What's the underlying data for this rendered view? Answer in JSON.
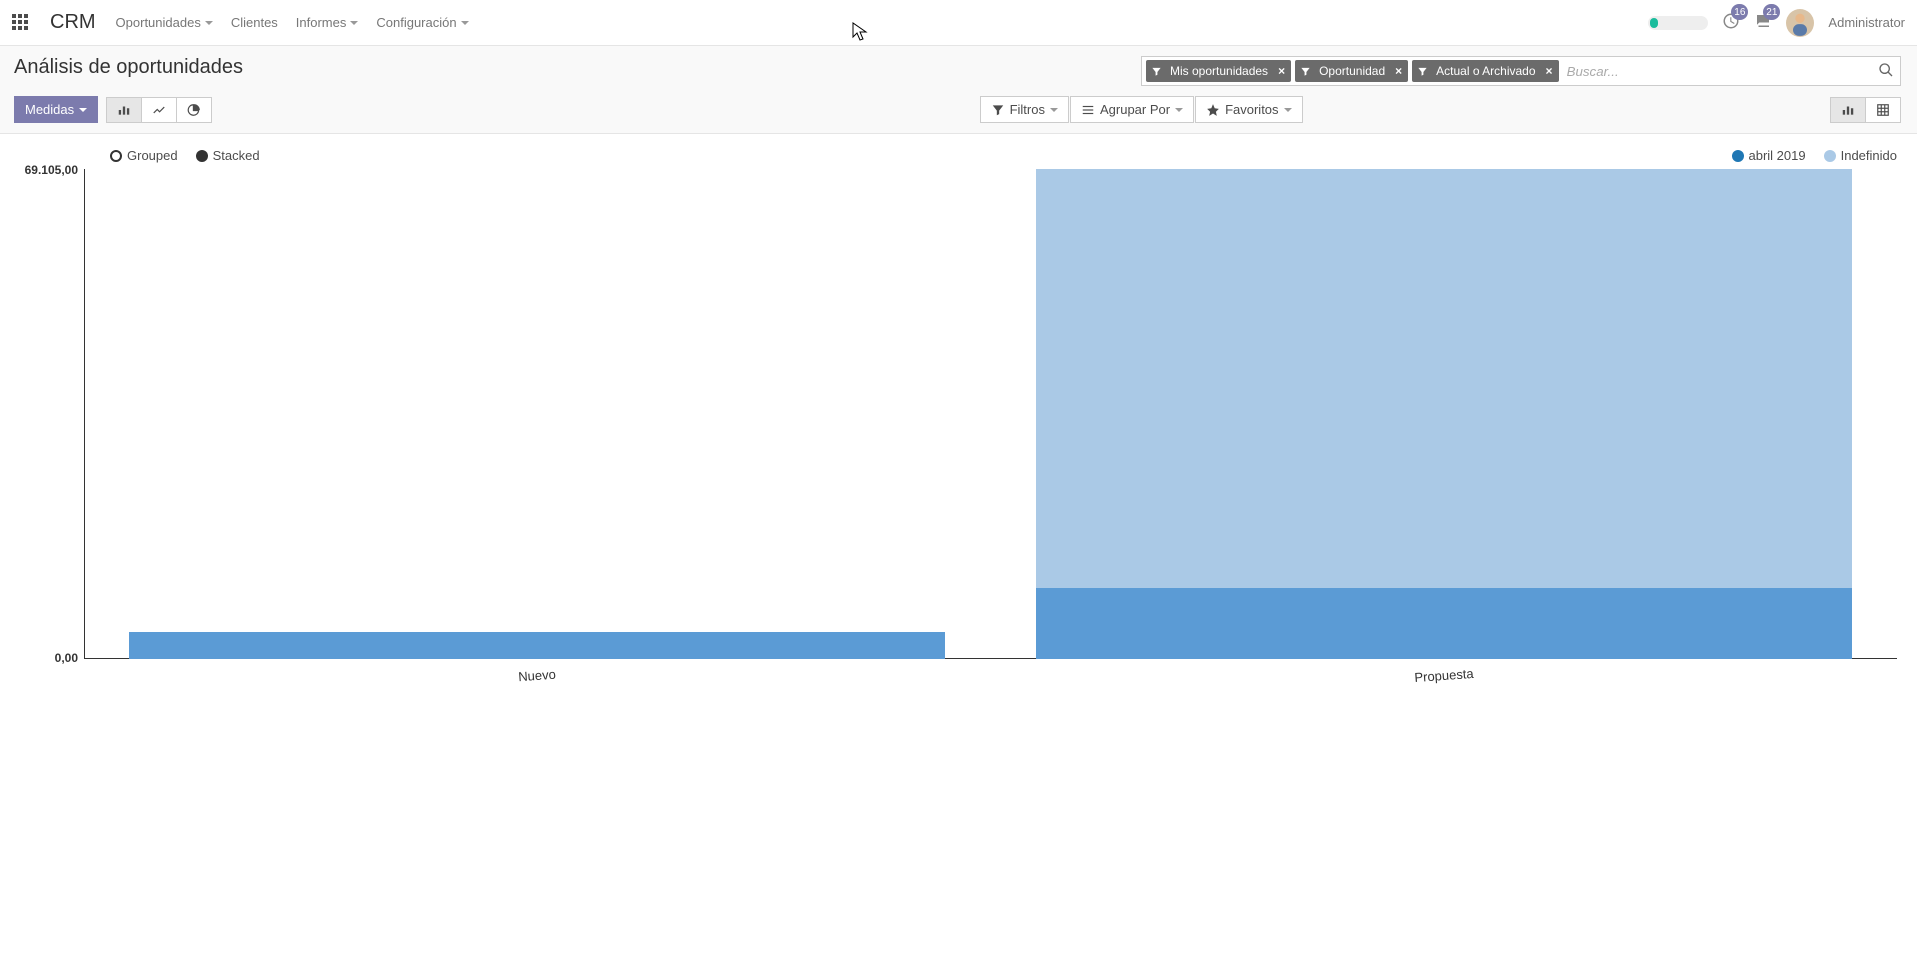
{
  "navbar": {
    "brand": "CRM",
    "menu": {
      "oportunidades": "Oportunidades",
      "clientes": "Clientes",
      "informes": "Informes",
      "configuracion": "Configuración"
    },
    "badges": {
      "activities": "16",
      "messages": "21"
    },
    "user": "Administrator"
  },
  "breadcrumb": "Análisis de oportunidades",
  "search": {
    "placeholder": "Buscar...",
    "facets": {
      "mis_oportunidades": "Mis oportunidades",
      "oportunidad": "Oportunidad",
      "actual_archivado": "Actual o Archivado"
    }
  },
  "toolbar": {
    "medidas": "Medidas",
    "filtros": "Filtros",
    "agrupar": "Agrupar Por",
    "favoritos": "Favoritos"
  },
  "chart": {
    "legend_mode": {
      "grouped": "Grouped",
      "stacked": "Stacked"
    },
    "legend_series": {
      "abril_2019": "abril 2019",
      "indefinido": "Indefinido"
    },
    "y_ticks": {
      "max": "69.105,00",
      "min": "0,00"
    },
    "categories": {
      "nuevo": "Nuevo",
      "propuesta": "Propuesta"
    }
  },
  "colors": {
    "abril_2019": "#5b9bd5",
    "indefinido": "#aac9e6",
    "stacked_dot": "#333",
    "grouped_dot_border": "#333"
  },
  "chart_data": {
    "type": "bar",
    "stacked": true,
    "xlabel": "",
    "ylabel": "",
    "ylim": [
      0,
      69105
    ],
    "y_ticks_shown": [
      0,
      69105
    ],
    "categories": [
      "Nuevo",
      "Propuesta"
    ],
    "series": [
      {
        "name": "abril 2019",
        "color": "#5b9bd5",
        "values": [
          3800,
          10000
        ]
      },
      {
        "name": "Indefinido",
        "color": "#aac9e6",
        "values": [
          0,
          59105
        ]
      }
    ],
    "legend_mode_selected": "Stacked",
    "legend_position": "top"
  }
}
